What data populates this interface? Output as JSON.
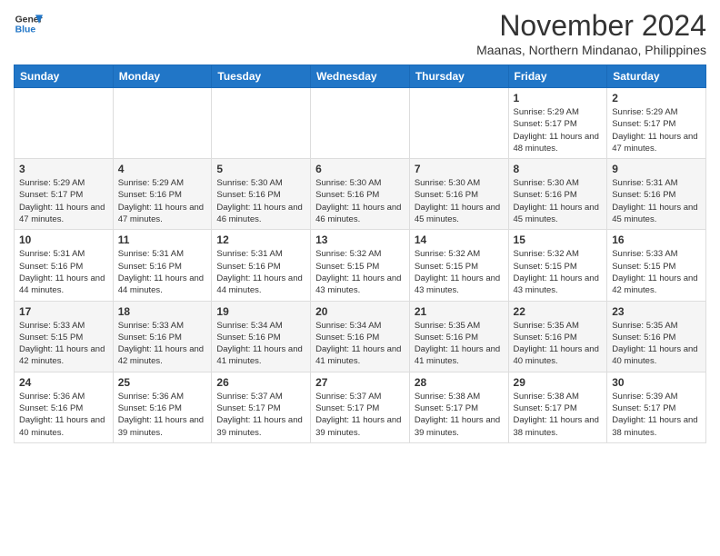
{
  "header": {
    "logo_line1": "General",
    "logo_line2": "Blue",
    "month": "November 2024",
    "location": "Maanas, Northern Mindanao, Philippines"
  },
  "weekdays": [
    "Sunday",
    "Monday",
    "Tuesday",
    "Wednesday",
    "Thursday",
    "Friday",
    "Saturday"
  ],
  "weeks": [
    [
      {
        "day": "",
        "info": ""
      },
      {
        "day": "",
        "info": ""
      },
      {
        "day": "",
        "info": ""
      },
      {
        "day": "",
        "info": ""
      },
      {
        "day": "",
        "info": ""
      },
      {
        "day": "1",
        "info": "Sunrise: 5:29 AM\nSunset: 5:17 PM\nDaylight: 11 hours and 48 minutes."
      },
      {
        "day": "2",
        "info": "Sunrise: 5:29 AM\nSunset: 5:17 PM\nDaylight: 11 hours and 47 minutes."
      }
    ],
    [
      {
        "day": "3",
        "info": "Sunrise: 5:29 AM\nSunset: 5:17 PM\nDaylight: 11 hours and 47 minutes."
      },
      {
        "day": "4",
        "info": "Sunrise: 5:29 AM\nSunset: 5:16 PM\nDaylight: 11 hours and 47 minutes."
      },
      {
        "day": "5",
        "info": "Sunrise: 5:30 AM\nSunset: 5:16 PM\nDaylight: 11 hours and 46 minutes."
      },
      {
        "day": "6",
        "info": "Sunrise: 5:30 AM\nSunset: 5:16 PM\nDaylight: 11 hours and 46 minutes."
      },
      {
        "day": "7",
        "info": "Sunrise: 5:30 AM\nSunset: 5:16 PM\nDaylight: 11 hours and 45 minutes."
      },
      {
        "day": "8",
        "info": "Sunrise: 5:30 AM\nSunset: 5:16 PM\nDaylight: 11 hours and 45 minutes."
      },
      {
        "day": "9",
        "info": "Sunrise: 5:31 AM\nSunset: 5:16 PM\nDaylight: 11 hours and 45 minutes."
      }
    ],
    [
      {
        "day": "10",
        "info": "Sunrise: 5:31 AM\nSunset: 5:16 PM\nDaylight: 11 hours and 44 minutes."
      },
      {
        "day": "11",
        "info": "Sunrise: 5:31 AM\nSunset: 5:16 PM\nDaylight: 11 hours and 44 minutes."
      },
      {
        "day": "12",
        "info": "Sunrise: 5:31 AM\nSunset: 5:16 PM\nDaylight: 11 hours and 44 minutes."
      },
      {
        "day": "13",
        "info": "Sunrise: 5:32 AM\nSunset: 5:15 PM\nDaylight: 11 hours and 43 minutes."
      },
      {
        "day": "14",
        "info": "Sunrise: 5:32 AM\nSunset: 5:15 PM\nDaylight: 11 hours and 43 minutes."
      },
      {
        "day": "15",
        "info": "Sunrise: 5:32 AM\nSunset: 5:15 PM\nDaylight: 11 hours and 43 minutes."
      },
      {
        "day": "16",
        "info": "Sunrise: 5:33 AM\nSunset: 5:15 PM\nDaylight: 11 hours and 42 minutes."
      }
    ],
    [
      {
        "day": "17",
        "info": "Sunrise: 5:33 AM\nSunset: 5:15 PM\nDaylight: 11 hours and 42 minutes."
      },
      {
        "day": "18",
        "info": "Sunrise: 5:33 AM\nSunset: 5:16 PM\nDaylight: 11 hours and 42 minutes."
      },
      {
        "day": "19",
        "info": "Sunrise: 5:34 AM\nSunset: 5:16 PM\nDaylight: 11 hours and 41 minutes."
      },
      {
        "day": "20",
        "info": "Sunrise: 5:34 AM\nSunset: 5:16 PM\nDaylight: 11 hours and 41 minutes."
      },
      {
        "day": "21",
        "info": "Sunrise: 5:35 AM\nSunset: 5:16 PM\nDaylight: 11 hours and 41 minutes."
      },
      {
        "day": "22",
        "info": "Sunrise: 5:35 AM\nSunset: 5:16 PM\nDaylight: 11 hours and 40 minutes."
      },
      {
        "day": "23",
        "info": "Sunrise: 5:35 AM\nSunset: 5:16 PM\nDaylight: 11 hours and 40 minutes."
      }
    ],
    [
      {
        "day": "24",
        "info": "Sunrise: 5:36 AM\nSunset: 5:16 PM\nDaylight: 11 hours and 40 minutes."
      },
      {
        "day": "25",
        "info": "Sunrise: 5:36 AM\nSunset: 5:16 PM\nDaylight: 11 hours and 39 minutes."
      },
      {
        "day": "26",
        "info": "Sunrise: 5:37 AM\nSunset: 5:17 PM\nDaylight: 11 hours and 39 minutes."
      },
      {
        "day": "27",
        "info": "Sunrise: 5:37 AM\nSunset: 5:17 PM\nDaylight: 11 hours and 39 minutes."
      },
      {
        "day": "28",
        "info": "Sunrise: 5:38 AM\nSunset: 5:17 PM\nDaylight: 11 hours and 39 minutes."
      },
      {
        "day": "29",
        "info": "Sunrise: 5:38 AM\nSunset: 5:17 PM\nDaylight: 11 hours and 38 minutes."
      },
      {
        "day": "30",
        "info": "Sunrise: 5:39 AM\nSunset: 5:17 PM\nDaylight: 11 hours and 38 minutes."
      }
    ]
  ]
}
